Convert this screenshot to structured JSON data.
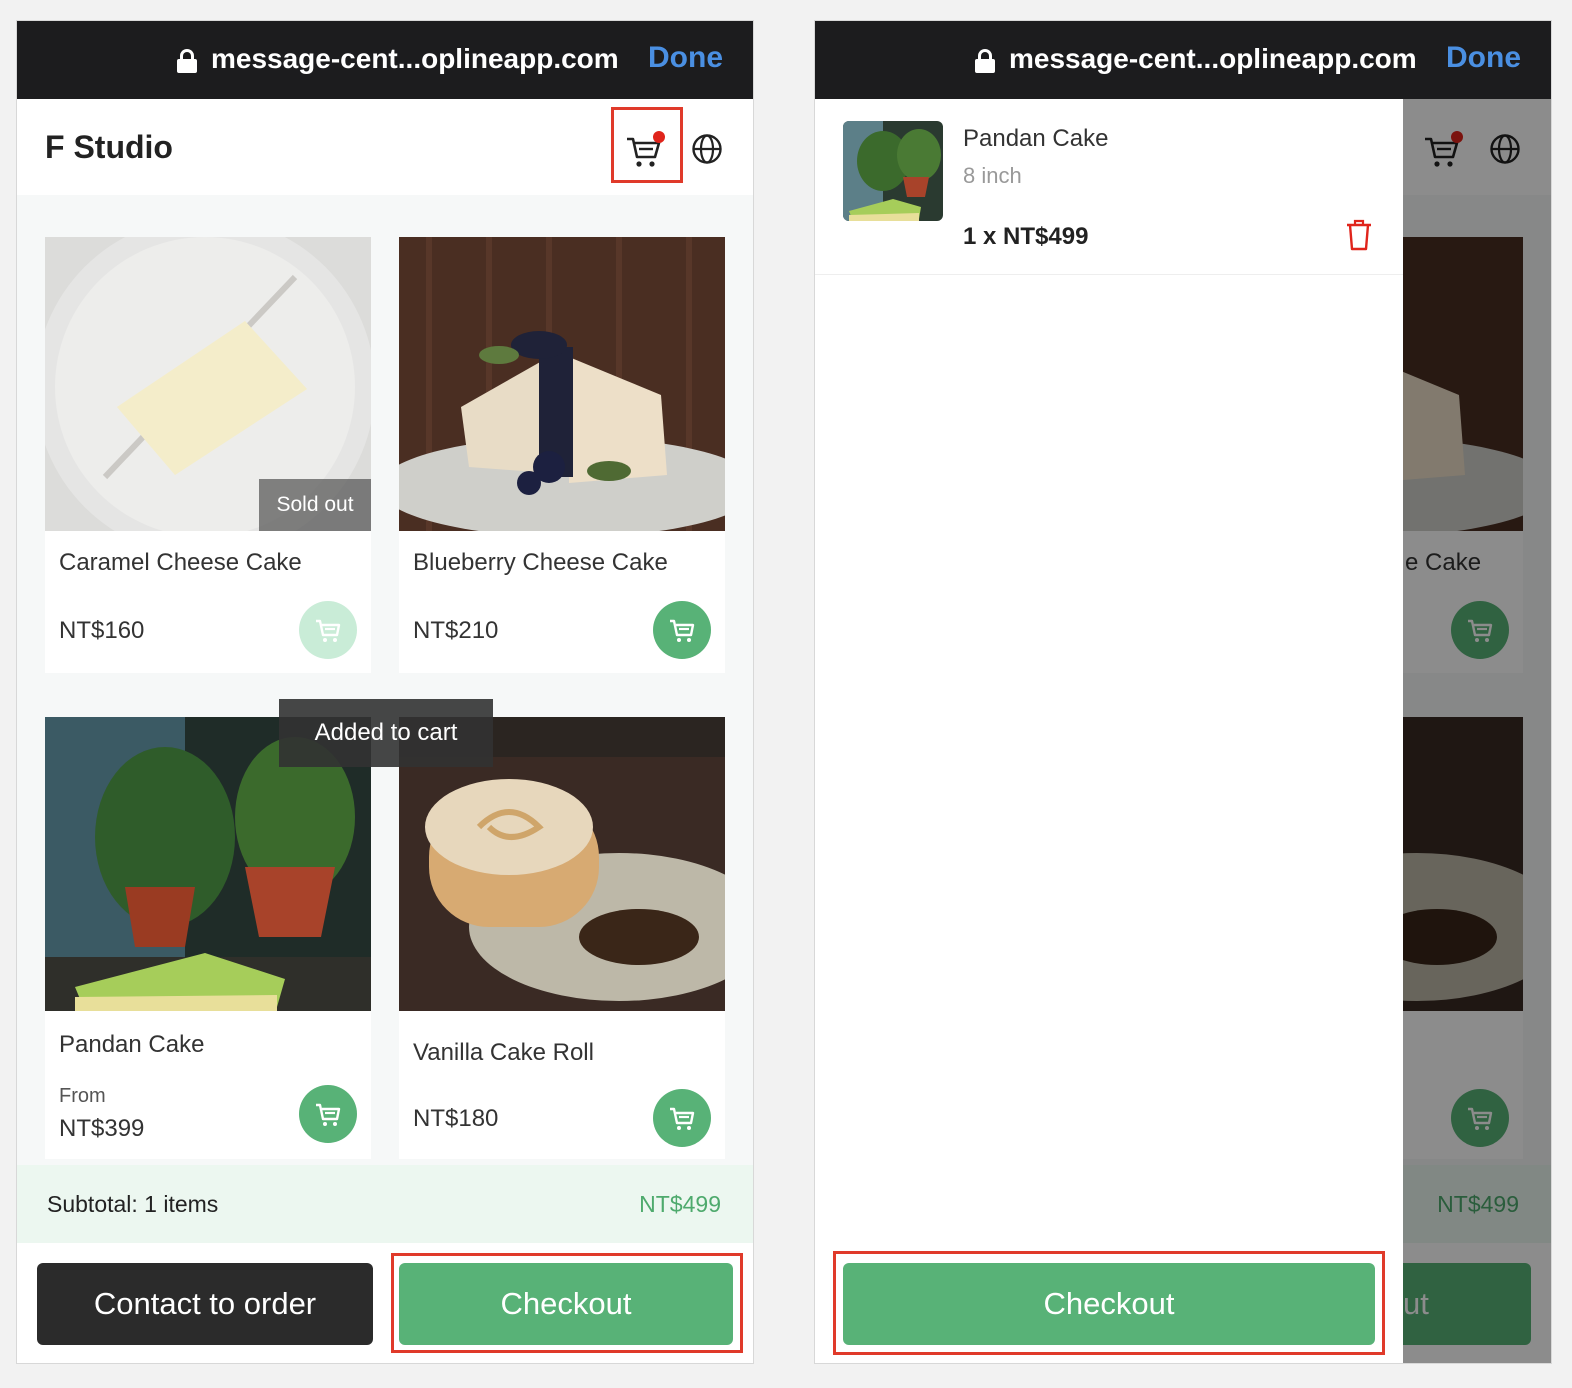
{
  "browser": {
    "url": "message-cent...oplineapp.com",
    "done_label": "Done"
  },
  "store": {
    "title": "F Studio"
  },
  "products": [
    {
      "name": "Caramel Cheese Cake",
      "price": "NT$160",
      "badge": "Sold out",
      "available": false
    },
    {
      "name": "Blueberry Cheese Cake",
      "price": "NT$210",
      "available": true
    },
    {
      "name": "Pandan Cake",
      "price_prefix": "From",
      "price": "NT$399",
      "available": true
    },
    {
      "name": "Vanilla Cake Roll",
      "price": "NT$180",
      "available": true
    }
  ],
  "toast": "Added to cart",
  "footer": {
    "subtotal_label": "Subtotal: 1 items",
    "subtotal_amount": "NT$499",
    "contact_label": "Contact to order",
    "checkout_label": "Checkout"
  },
  "cart_drawer": {
    "items": [
      {
        "name": "Pandan Cake",
        "variant": "8 inch",
        "quantity_price": "1 x NT$499"
      }
    ],
    "checkout_label": "Checkout"
  },
  "background_peek": {
    "name_fragment_1": "e Cake",
    "checkout_fragment": "ut"
  },
  "colors": {
    "accent_green": "#58b277",
    "highlight_red": "#e03a2a",
    "link_blue": "#4a8fe2"
  }
}
